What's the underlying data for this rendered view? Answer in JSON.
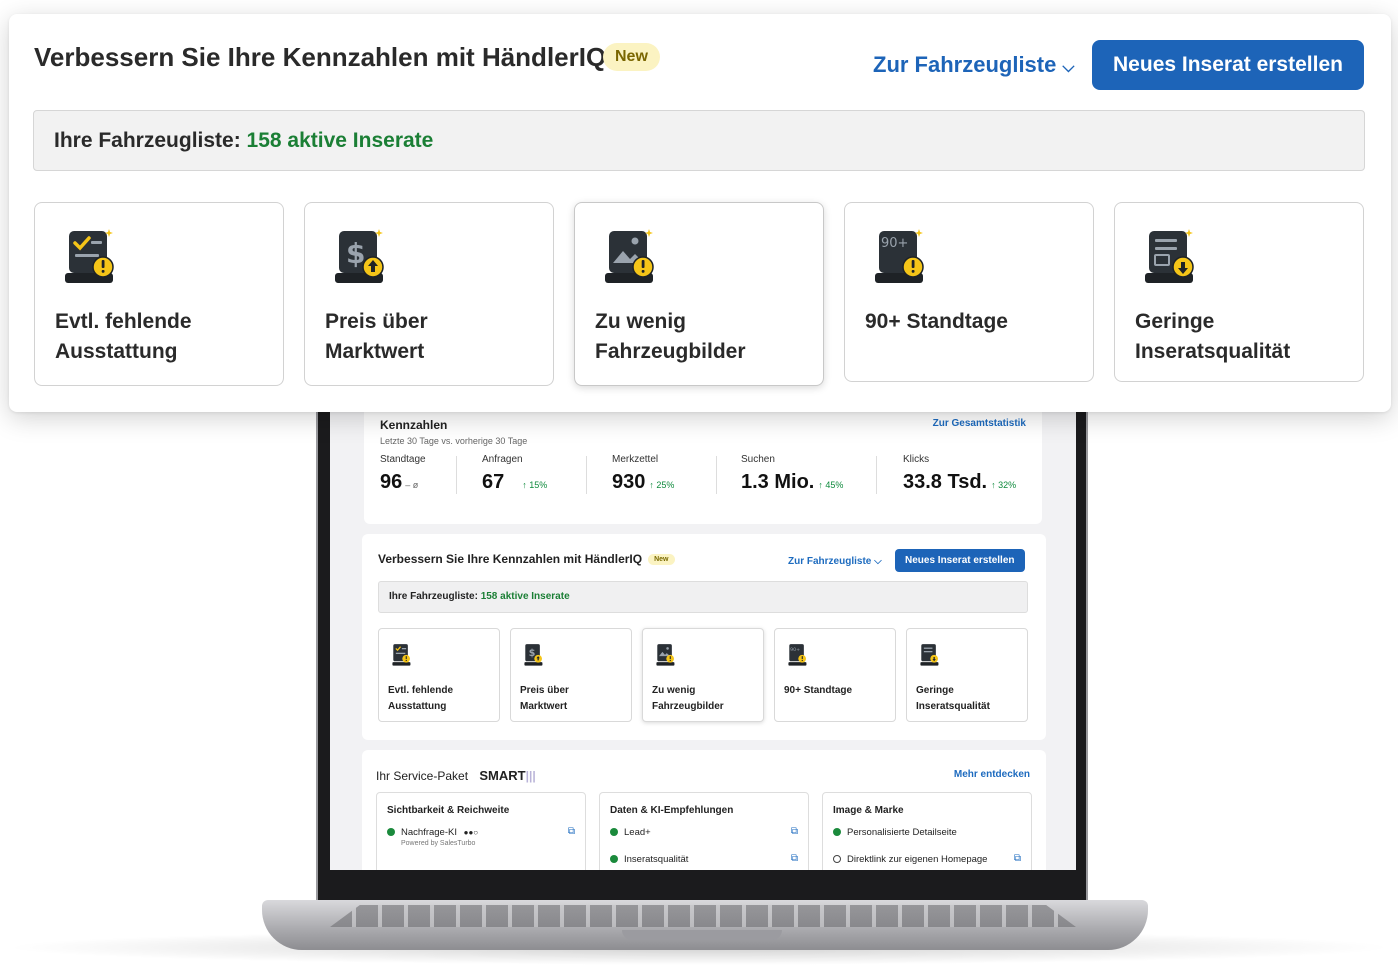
{
  "header": {
    "title": "Verbessern Sie Ihre Kennzahlen mit HändlerIQ",
    "badge": "New",
    "vehicle_list_link": "Zur Fahrzeugliste",
    "create_button": "Neues Inserat erstellen"
  },
  "banner": {
    "label": "Ihre Fahrzeugliste:",
    "count_text": "158 aktive Inserate"
  },
  "tiles": [
    {
      "label_line1": "Evtl. fehlende",
      "label_line2": "Ausstattung",
      "icon": "checklist-warning-icon"
    },
    {
      "label_line1": "Preis über",
      "label_line2": "Marktwert",
      "icon": "price-up-icon"
    },
    {
      "label_line1": "Zu wenig",
      "label_line2": "Fahrzeugbilder",
      "icon": "image-warning-icon"
    },
    {
      "label_line1": "90+ Standtage",
      "label_line2": "",
      "icon": "calendar-90-icon"
    },
    {
      "label_line1": "Geringe",
      "label_line2": "Inseratsqualität",
      "icon": "document-down-icon"
    }
  ],
  "screen": {
    "kpis": {
      "title": "Kennzahlen",
      "subtitle": "Letzte 30 Tage vs. vorherige 30 Tage",
      "link": "Zur Gesamtstatistik",
      "items": [
        {
          "label": "Standtage",
          "value": "96",
          "change": "– ø"
        },
        {
          "label": "Anfragen",
          "value": "67",
          "change": "↑ 15%"
        },
        {
          "label": "Merkzettel",
          "value": "930",
          "change": "↑ 25%"
        },
        {
          "label": "Suchen",
          "value": "1.3 Mio.",
          "change": "↑ 45%"
        },
        {
          "label": "Klicks",
          "value": "33.8 Tsd.",
          "change": "↑ 32%"
        }
      ]
    },
    "improve": {
      "title": "Verbessern Sie Ihre Kennzahlen mit HändlerIQ",
      "badge": "New",
      "link": "Zur Fahrzeugliste",
      "button": "Neues Inserat erstellen",
      "banner_label": "Ihre Fahrzeugliste:",
      "banner_count": "158 aktive Inserate"
    },
    "service": {
      "title": "Ihr Service-Paket",
      "package": "SMART",
      "link": "Mehr entdecken",
      "columns": [
        {
          "heading": "Sichtbarkeit & Reichweite",
          "items": [
            {
              "label": "Nachfrage-KI",
              "extra": "●●○",
              "note": "Powered by SalesTurbo"
            }
          ]
        },
        {
          "heading": "Daten & KI-Empfehlungen",
          "items": [
            {
              "label": "Lead+"
            },
            {
              "label": "Inseratsqualität"
            }
          ]
        },
        {
          "heading": "Image & Marke",
          "items": [
            {
              "label": "Personalisierte Detailseite"
            },
            {
              "label": "Direktlink zur eigenen Homepage"
            }
          ]
        }
      ]
    }
  },
  "colors": {
    "primary": "#1d64b8",
    "positive": "#1b7f35",
    "badge_bg": "#fbf3c2",
    "warning": "#f5c518",
    "icon_dark": "#1e2226"
  }
}
